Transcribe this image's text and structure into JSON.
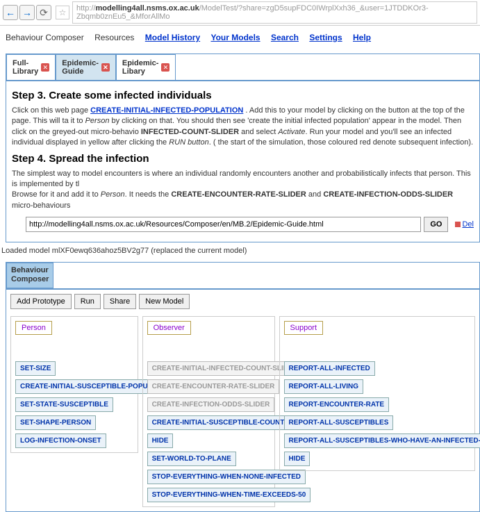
{
  "browser": {
    "url_domain": "modelling4all.nsms.ox.ac.uk",
    "url_prefix": "http://",
    "url_path": "/ModelTest/?share=zgD5supFDC0IWrplXxh36_&user=1JTDDKOr3-Zbqmb0znEu5_&MforAllMo"
  },
  "menu": {
    "items": [
      "Behaviour Composer",
      "Resources",
      "Model History",
      "Your Models",
      "Search",
      "Settings",
      "Help"
    ],
    "linked": [
      false,
      false,
      true,
      true,
      true,
      true,
      true
    ]
  },
  "tabs": [
    {
      "line1": "Full-",
      "line2": "Library",
      "active": false
    },
    {
      "line1": "Epidemic-",
      "line2": "Guide",
      "active": true
    },
    {
      "line1": "Epidemic-",
      "line2": "Libary",
      "active": false
    }
  ],
  "step3": {
    "title": "Step 3. Create some infected individuals",
    "text1a": "Click on this web page ",
    "link": "CREATE-INITIAL-INFECTED-POPULATION",
    "text1b": " . Add this to your model by clicking on the button at the top of the page. This will ta",
    "text2a": "it to ",
    "person": "Person",
    "text2b": " by clicking  on that. You should then see 'create the initial infected population' appear in the model. Then click on the greyed-out micro-behavio",
    "bold1": "INFECTED-COUNT-SLIDER",
    "text3a": " and select ",
    "activate": "Activate",
    "text3b": ". Run your model and you'll see an infected individual displayed in yellow after clicking the ",
    "runbtn": "RUN button",
    "text3c": ". (",
    "text4": "the start of the simulation, those coloured red denote subsequent infection)."
  },
  "step4": {
    "title": "Step 4. Spread the infection",
    "text1": "The simplest way to model encounters is where an individual randomly encounters another and probabilistically infects that person. This is implemented by tl",
    "text2a": "Browse for it and add it to ",
    "person": "Person",
    "text2b": ". It needs the ",
    "bold1": "CREATE-ENCOUNTER-RATE-SLIDER",
    "text2c": " and ",
    "bold2": "CREATE-INFECTION-ODDS-SLIDER",
    "text2d": " micro-behaviours"
  },
  "go": {
    "url": "http://modelling4all.nsms.ox.ac.uk/Resources/Composer/en/MB.2/Epidemic-Guide.html",
    "btn": "GO",
    "del": "Del"
  },
  "status": "Loaded model mlXF0ewq636ahoz5BV2g77 (replaced the current model)",
  "composer": {
    "tab1": "Behaviour",
    "tab2": "Composer",
    "toolbar": [
      "Add Prototype",
      "Run",
      "Share",
      "New Model"
    ]
  },
  "personPanel": {
    "title": "Person",
    "items": [
      {
        "label": "SET-SIZE",
        "disabled": false
      },
      {
        "label": "CREATE-INITIAL-SUSCEPTIBLE-POPULATION",
        "disabled": false
      },
      {
        "label": "SET-STATE-SUSCEPTIBLE",
        "disabled": false
      },
      {
        "label": "SET-SHAPE-PERSON",
        "disabled": false
      },
      {
        "label": "LOG-INFECTION-ONSET",
        "disabled": false
      }
    ]
  },
  "observerPanel": {
    "title": "Observer",
    "items": [
      {
        "label": "CREATE-INITIAL-INFECTED-COUNT-SLIDER",
        "disabled": true
      },
      {
        "label": "CREATE-ENCOUNTER-RATE-SLIDER",
        "disabled": true
      },
      {
        "label": "CREATE-INFECTION-ODDS-SLIDER",
        "disabled": true
      },
      {
        "label": "CREATE-INITIAL-SUSCEPTIBLE-COUNT-SLIDER",
        "disabled": false
      },
      {
        "label": "HIDE",
        "disabled": false
      },
      {
        "label": "SET-WORLD-TO-PLANE",
        "disabled": false
      },
      {
        "label": "STOP-EVERYTHING-WHEN-NONE-INFECTED",
        "disabled": false
      },
      {
        "label": "STOP-EVERYTHING-WHEN-TIME-EXCEEDS-50",
        "disabled": false
      }
    ]
  },
  "supportPanel": {
    "title": "Support",
    "items": [
      {
        "label": "REPORT-ALL-INFECTED",
        "disabled": false
      },
      {
        "label": "REPORT-ALL-LIVING",
        "disabled": false
      },
      {
        "label": "REPORT-ENCOUNTER-RATE",
        "disabled": false
      },
      {
        "label": "REPORT-ALL-SUSCEPTIBLES",
        "disabled": false
      },
      {
        "label": "REPORT-ALL-SUSCEPTIBLES-WHO-HAVE-AN-INFECTED-ACQUAINTANCE",
        "disabled": false
      },
      {
        "label": "HIDE",
        "disabled": false
      }
    ]
  }
}
